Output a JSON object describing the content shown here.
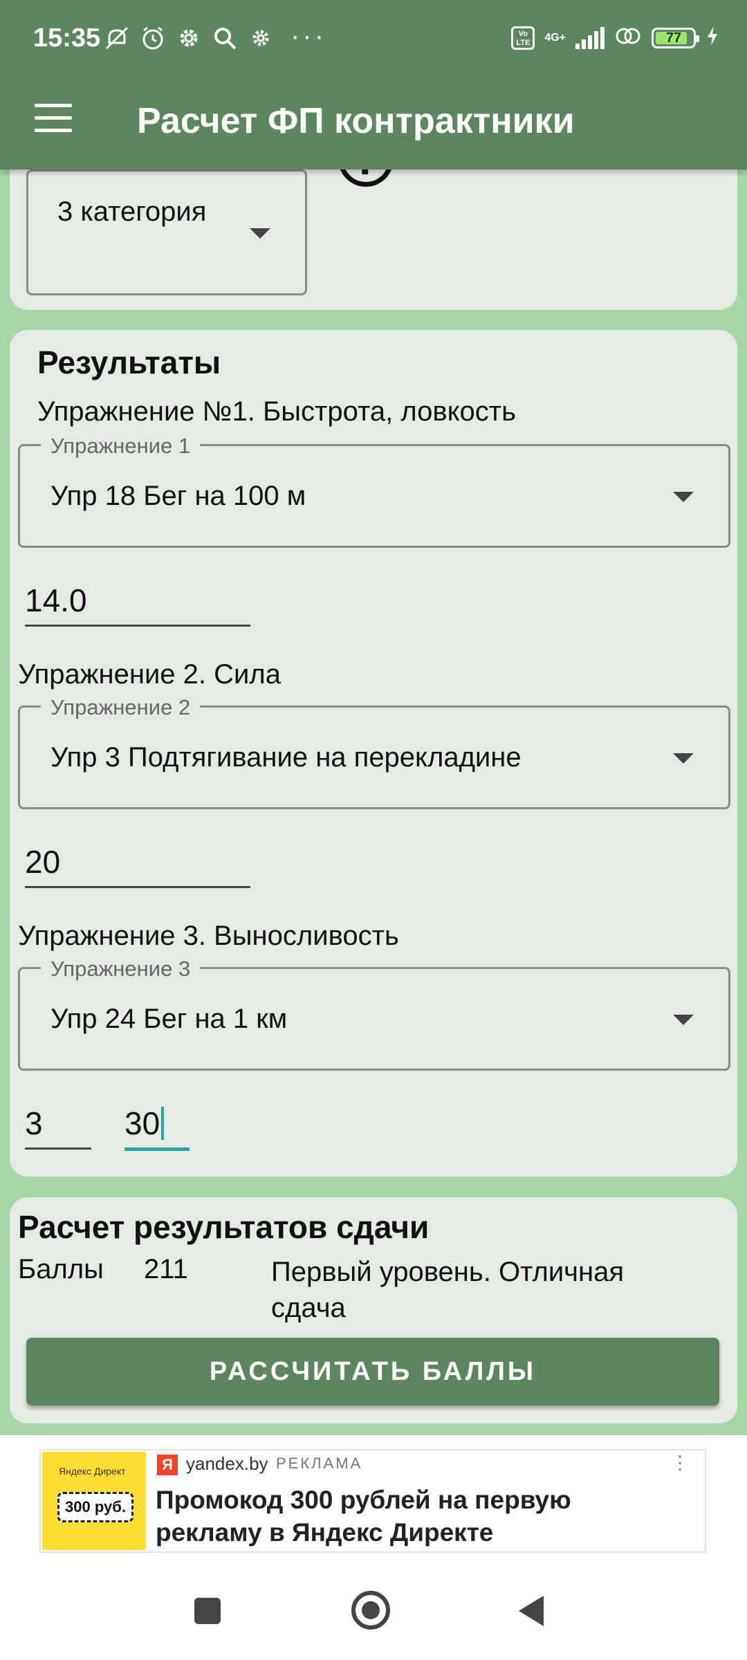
{
  "status_bar": {
    "time": "15:35",
    "icons": [
      "mute-icon",
      "alarm-icon",
      "gear-icon",
      "search-icon",
      "settings-icon"
    ],
    "more": "···",
    "volte": "Vo LTE",
    "network": "4G+",
    "battery": "77"
  },
  "app_bar": {
    "title": "Расчет ФП контрактники"
  },
  "category": {
    "value": "3 категория"
  },
  "results": {
    "heading": "Результаты",
    "exercise1": {
      "label": "Упражнение №1. Быстрота, ловкость",
      "legend": "Упражнение 1",
      "selected": "Упр 18 Бег на 100 м",
      "input": "14.0"
    },
    "exercise2": {
      "label": "Упражнение 2. Сила",
      "legend": "Упражнение 2",
      "selected": "Упр 3 Подтягивание на перекладине",
      "input": "20"
    },
    "exercise3": {
      "label": "Упражнение 3. Выносливость",
      "legend": "Упражнение 3",
      "selected": "Упр 24 Бег на 1 км",
      "minutes": "3",
      "seconds": "30"
    }
  },
  "calculation": {
    "title": "Расчет результатов сдачи",
    "score_label": "Баллы",
    "score_value": "211",
    "score_text": "Первый уровень. Отличная сдача",
    "button": "РАССЧИТАТЬ БАЛЛЫ"
  },
  "ad": {
    "image_brand": "Яндекс Директ",
    "image_coupon": "300 руб.",
    "icon_letter": "Я",
    "domain": "yandex.by",
    "label": "РЕКЛАМА",
    "more": "⋮",
    "headline": "Промокод 300 рублей на первую рекламу в Яндекс Директе"
  }
}
